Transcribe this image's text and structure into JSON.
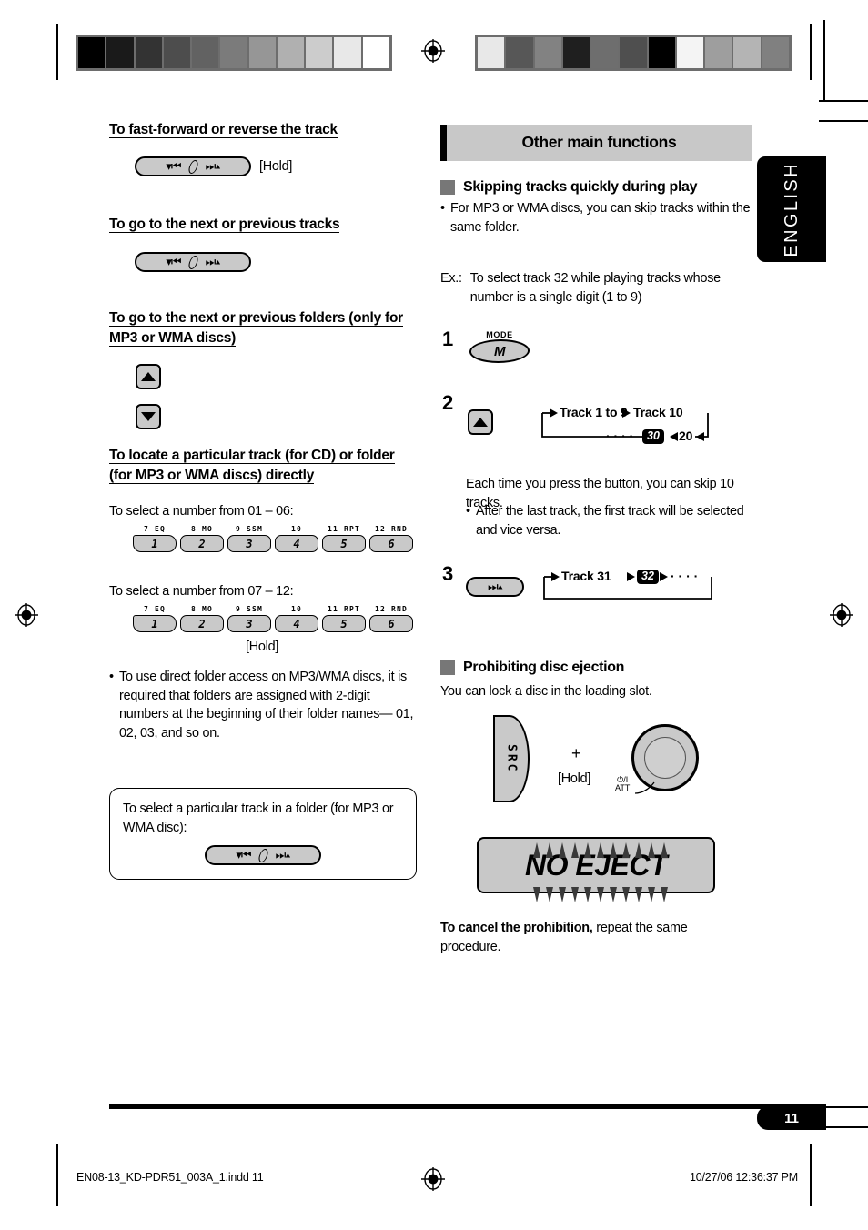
{
  "page": {
    "number": "11",
    "language_tab": "ENGLISH"
  },
  "left_column": {
    "section_ff": {
      "heading": "To fast-forward or reverse the track",
      "hold_label": "[Hold]"
    },
    "section_next_track": {
      "heading": "To go to the next or previous tracks"
    },
    "section_folders": {
      "heading": "To go to the next or previous folders (only for MP3 or WMA discs)"
    },
    "section_locate": {
      "heading": "To locate a particular track (for CD) or folder (for MP3 or WMA discs) directly",
      "line_01_06": "To select a number from 01 – 06:",
      "line_07_12": "To select a number from 07 – 12:",
      "hold_label": "[Hold]",
      "number_keys": [
        {
          "cap": "7  EQ",
          "num": "1"
        },
        {
          "cap": "8  MO",
          "num": "2"
        },
        {
          "cap": "9  SSM",
          "num": "3"
        },
        {
          "cap": "10",
          "num": "4"
        },
        {
          "cap": "11  RPT",
          "num": "5"
        },
        {
          "cap": "12  RND",
          "num": "6"
        }
      ],
      "note_bullet": "•",
      "note_text": "To use direct folder access on MP3/WMA discs, it is required that folders are assigned with 2-digit numbers at the beginning of their folder names— 01, 02, 03, and so on."
    },
    "callout": {
      "text": "To select a particular track in a folder (for MP3 or WMA disc):"
    }
  },
  "right_column": {
    "band_title": "Other main functions",
    "skip": {
      "heading": "Skipping tracks quickly during play",
      "bullet": "•",
      "bullet_text": "For MP3 or WMA discs, you can skip tracks within the same folder.",
      "ex_label": "Ex.:",
      "ex_text": "To select track 32 while playing tracks whose number is a single digit (1 to 9)",
      "steps": [
        {
          "n": "1"
        },
        {
          "n": "2"
        },
        {
          "n": "3"
        }
      ],
      "step1_button": {
        "cap": "MODE",
        "key": "M"
      },
      "step2_flow": {
        "a": "Track 1 to 9",
        "b": "Track 10",
        "dots": "· · · ·",
        "chip": "30",
        "c": "20"
      },
      "step2_note": "Each time you press the button, you can skip 10 tracks.",
      "step2_bullet": "•",
      "step2_bullet_text": "After the last track, the first track will be selected and vice versa.",
      "step3_flow": {
        "a": "Track 31",
        "chip": "32",
        "dots": "· · · ·"
      }
    },
    "prohibit": {
      "heading": "Prohibiting disc ejection",
      "intro": "You can lock a disc in the loading slot.",
      "src_label": "SRC",
      "plus": "+",
      "hold_label": "[Hold]",
      "knob_label_top": "⏻/I",
      "knob_label_bottom": "ATT",
      "display_text": "NO EJECT",
      "cancel_bold": "To cancel the prohibition,",
      "cancel_rest": " repeat the same procedure."
    }
  },
  "footer": {
    "file_name": "EN08-13_KD-PDR51_003A_1.indd   11",
    "timestamp": "10/27/06   12:36:37 PM"
  },
  "colorbars": {
    "left": [
      "#000000",
      "#1a1a1a",
      "#333333",
      "#4d4d4d",
      "#626262",
      "#7b7b7b",
      "#969696",
      "#b0b0b0",
      "#cccccc",
      "#e8e8e8",
      "#ffffff"
    ],
    "right": [
      "#e8e8e8",
      "#575757",
      "#828282",
      "#1f1f1f",
      "#6e6e6e",
      "#4f4f4f",
      "#000000",
      "#f4f4f4",
      "#9e9e9e",
      "#b4b4b4",
      "#808080"
    ]
  }
}
